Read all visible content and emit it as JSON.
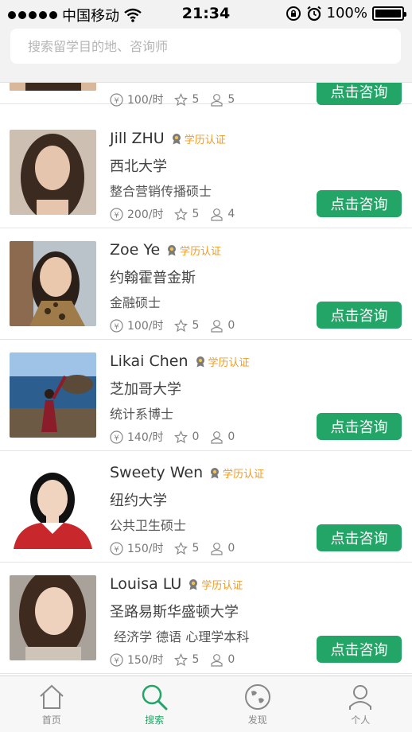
{
  "status_bar": {
    "carrier": "中国移动",
    "time": "21:34",
    "battery": "100%"
  },
  "search": {
    "placeholder": "搜索留学目的地、咨询师"
  },
  "consultants": [
    {
      "name": "",
      "badge": "",
      "school": "",
      "major": "",
      "price": "100/时",
      "rating": "5",
      "count": "5",
      "button": "点击咨询"
    },
    {
      "name": "Jill ZHU",
      "badge": "学历认证",
      "school": "西北大学",
      "major": "整合营销传播硕士",
      "price": "200/时",
      "rating": "5",
      "count": "4",
      "button": "点击咨询"
    },
    {
      "name": "Zoe Ye",
      "badge": "学历认证",
      "school": "约翰霍普金斯",
      "major": "金融硕士",
      "price": "100/时",
      "rating": "5",
      "count": "0",
      "button": "点击咨询"
    },
    {
      "name": "Likai Chen",
      "badge": "学历认证",
      "school": "芝加哥大学",
      "major": "统计系博士",
      "price": "140/时",
      "rating": "0",
      "count": "0",
      "button": "点击咨询"
    },
    {
      "name": "Sweety Wen",
      "badge": "学历认证",
      "school": "纽约大学",
      "major": "公共卫生硕士",
      "price": "150/时",
      "rating": "5",
      "count": "0",
      "button": "点击咨询"
    },
    {
      "name": "Louisa LU",
      "badge": "学历认证",
      "school": "圣路易斯华盛顿大学",
      "major": " 经济学 德语 心理学本科",
      "price": "150/时",
      "rating": "5",
      "count": "0",
      "button": "点击咨询"
    }
  ],
  "tabs": [
    {
      "label": "首页",
      "icon": "home-icon"
    },
    {
      "label": "搜索",
      "icon": "search-icon",
      "active": true
    },
    {
      "label": "发现",
      "icon": "globe-icon"
    },
    {
      "label": "个人",
      "icon": "person-icon"
    }
  ],
  "colors": {
    "accent": "#23a567",
    "badge": "#f29a1f"
  }
}
